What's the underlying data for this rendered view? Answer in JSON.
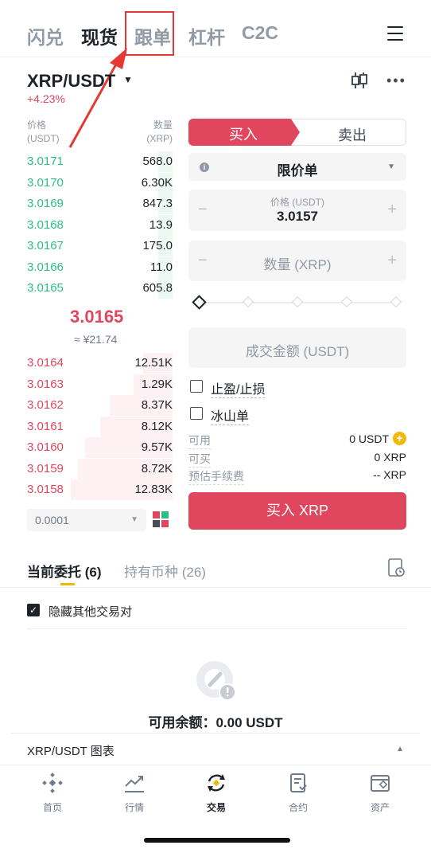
{
  "top_tabs": [
    "闪兑",
    "现货",
    "跟单",
    "杠杆",
    "C2C"
  ],
  "active_top_tab": "现货",
  "pair": {
    "name": "XRP/USDT",
    "change": "+4.23%"
  },
  "order_book": {
    "price_header": "价格",
    "price_unit": "(USDT)",
    "qty_header": "数量",
    "qty_unit": "(XRP)",
    "asks": [
      {
        "price": "3.0171",
        "qty": "568.0",
        "depth": 0.1
      },
      {
        "price": "3.0170",
        "qty": "6.30K",
        "depth": 0.1
      },
      {
        "price": "3.0169",
        "qty": "847.3",
        "depth": 0.1
      },
      {
        "price": "3.0168",
        "qty": "13.9",
        "depth": 0.1
      },
      {
        "price": "3.0167",
        "qty": "175.0",
        "depth": 0.1
      },
      {
        "price": "3.0166",
        "qty": "11.0",
        "depth": 0.1
      },
      {
        "price": "3.0165",
        "qty": "605.8",
        "depth": 0.1
      }
    ],
    "mid_price": "3.0165",
    "mid_fiat": "≈ ¥21.74",
    "bids": [
      {
        "price": "3.0164",
        "qty": "12.51K",
        "depth": 0.2
      },
      {
        "price": "3.0163",
        "qty": "1.29K",
        "depth": 0.27
      },
      {
        "price": "3.0162",
        "qty": "8.37K",
        "depth": 0.43
      },
      {
        "price": "3.0161",
        "qty": "8.12K",
        "depth": 0.5
      },
      {
        "price": "3.0160",
        "qty": "9.57K",
        "depth": 0.6
      },
      {
        "price": "3.0159",
        "qty": "8.72K",
        "depth": 0.65
      },
      {
        "price": "3.0158",
        "qty": "12.83K",
        "depth": 0.7
      }
    ],
    "precision": "0.0001"
  },
  "trade_form": {
    "buy_tab": "买入",
    "sell_tab": "卖出",
    "order_type": "限价单",
    "price_label": "价格 (USDT)",
    "price_value": "3.0157",
    "qty_placeholder": "数量 (XRP)",
    "amount_placeholder": "成交金额 (USDT)",
    "tp_sl": "止盈/止损",
    "iceberg": "冰山单",
    "available_label": "可用",
    "available_value": "0 USDT",
    "can_buy_label": "可买",
    "can_buy_value": "0 XRP",
    "fee_label": "预估手续费",
    "fee_value": "-- XRP",
    "submit": "买入 XRP"
  },
  "orders": {
    "tab_open": "当前委托 (6)",
    "tab_holdings": "持有币种 (26)",
    "hide_other_pairs": "隐藏其他交易对",
    "balance": "可用余额：0.00 USDT",
    "chart_label": "XRP/USDT 图表"
  },
  "bottom_nav": [
    {
      "label": "首页",
      "icon": "home-icon"
    },
    {
      "label": "行情",
      "icon": "markets-icon"
    },
    {
      "label": "交易",
      "icon": "trade-icon"
    },
    {
      "label": "合约",
      "icon": "futures-icon"
    },
    {
      "label": "资产",
      "icon": "wallet-icon"
    }
  ],
  "active_nav": "交易",
  "colors": {
    "up": "#2ebd85",
    "down": "#e0465e",
    "accent": "#f0b90b"
  }
}
